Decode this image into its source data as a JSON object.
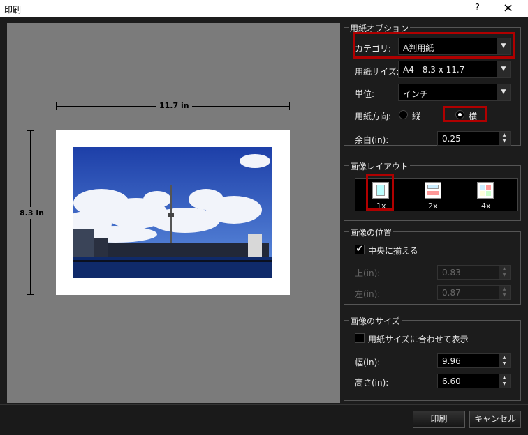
{
  "window": {
    "title": "印刷",
    "help": "?",
    "close": "×"
  },
  "preview": {
    "width_label": "11.7 in",
    "height_label": "8.3 in"
  },
  "paper_options": {
    "title": "用紙オプション",
    "category_label": "カテゴリ:",
    "category_value": "A判用紙",
    "size_label": "用紙サイズ:",
    "size_value": "A4 - 8.3 x 11.7",
    "unit_label": "単位:",
    "unit_value": "インチ",
    "orientation_label": "用紙方向:",
    "portrait": "縦",
    "landscape": "横",
    "orientation_selected": "横",
    "margin_label": "余白(in):",
    "margin_value": "0.25"
  },
  "image_layout": {
    "title": "画像レイアウト",
    "options": [
      "1x",
      "2x",
      "4x"
    ],
    "selected": "1x"
  },
  "image_position": {
    "title": "画像の位置",
    "center_label": "中央に揃える",
    "center_checked": true,
    "top_label": "上(in):",
    "top_value": "0.83",
    "left_label": "左(in):",
    "left_value": "0.87"
  },
  "image_size": {
    "title": "画像のサイズ",
    "fit_label": "用紙サイズに合わせて表示",
    "fit_checked": false,
    "width_label": "幅(in):",
    "width_value": "9.96",
    "height_label": "高さ(in):",
    "height_value": "6.60"
  },
  "footer": {
    "print": "印刷",
    "cancel": "キャンセル"
  },
  "colors": {
    "accent_red": "#b00000",
    "preview_bg": "#7b7b7b"
  }
}
